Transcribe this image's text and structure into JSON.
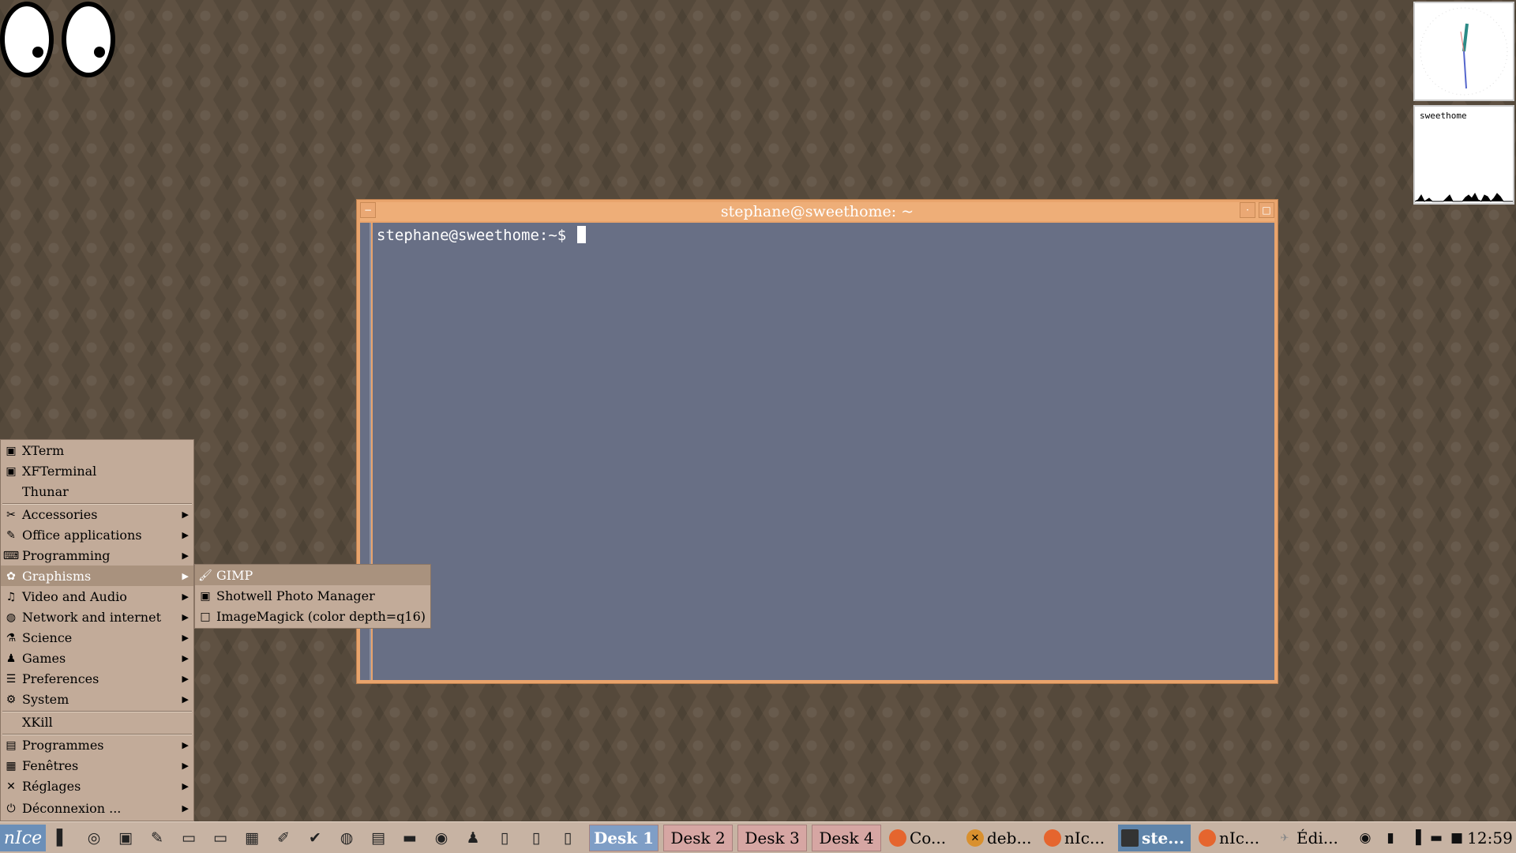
{
  "terminal": {
    "title": "stephane@sweethome: ~",
    "prompt": "stephane@sweethome:~$ "
  },
  "loadmon": {
    "hostname": "sweethome"
  },
  "menu": {
    "items": [
      {
        "label": "XTerm",
        "icon": "terminal-icon"
      },
      {
        "label": "XFTerminal",
        "icon": "terminal-icon"
      },
      {
        "label": "Thunar",
        "icon": ""
      },
      {
        "label": "Accessories",
        "icon": "accessories-icon"
      },
      {
        "label": "Office applications",
        "icon": "office-icon"
      },
      {
        "label": "Programming",
        "icon": "programming-icon"
      },
      {
        "label": "Graphisms",
        "icon": "graphics-icon"
      },
      {
        "label": "Video and Audio",
        "icon": "multimedia-icon"
      },
      {
        "label": "Network and internet",
        "icon": "network-icon"
      },
      {
        "label": "Science",
        "icon": "science-icon"
      },
      {
        "label": "Games",
        "icon": "games-icon"
      },
      {
        "label": "Preferences",
        "icon": "preferences-icon"
      },
      {
        "label": "System",
        "icon": "system-icon"
      },
      {
        "label": "XKill",
        "icon": ""
      },
      {
        "label": "Programmes",
        "icon": "programs-icon"
      },
      {
        "label": "Fenêtres",
        "icon": "windows-icon"
      },
      {
        "label": "Réglages",
        "icon": "settings-icon"
      },
      {
        "label": "Déconnexion ...",
        "icon": "logout-icon"
      }
    ],
    "submenu": [
      {
        "label": "GIMP",
        "icon": "gimp-icon"
      },
      {
        "label": "Shotwell Photo Manager",
        "icon": "shotwell-icon"
      },
      {
        "label": "ImageMagick (color depth=q16)",
        "icon": "imagemagick-icon"
      }
    ]
  },
  "taskbar": {
    "start_label": "nIce",
    "desks": [
      "Desk 1",
      "Desk 2",
      "Desk 3",
      "Desk 4"
    ],
    "active_desk": "Desk 1",
    "tasks": [
      "Co...",
      "deb...",
      "nIc...",
      "ste...",
      "nIc...",
      "Édi..."
    ],
    "clock": "12:59"
  }
}
